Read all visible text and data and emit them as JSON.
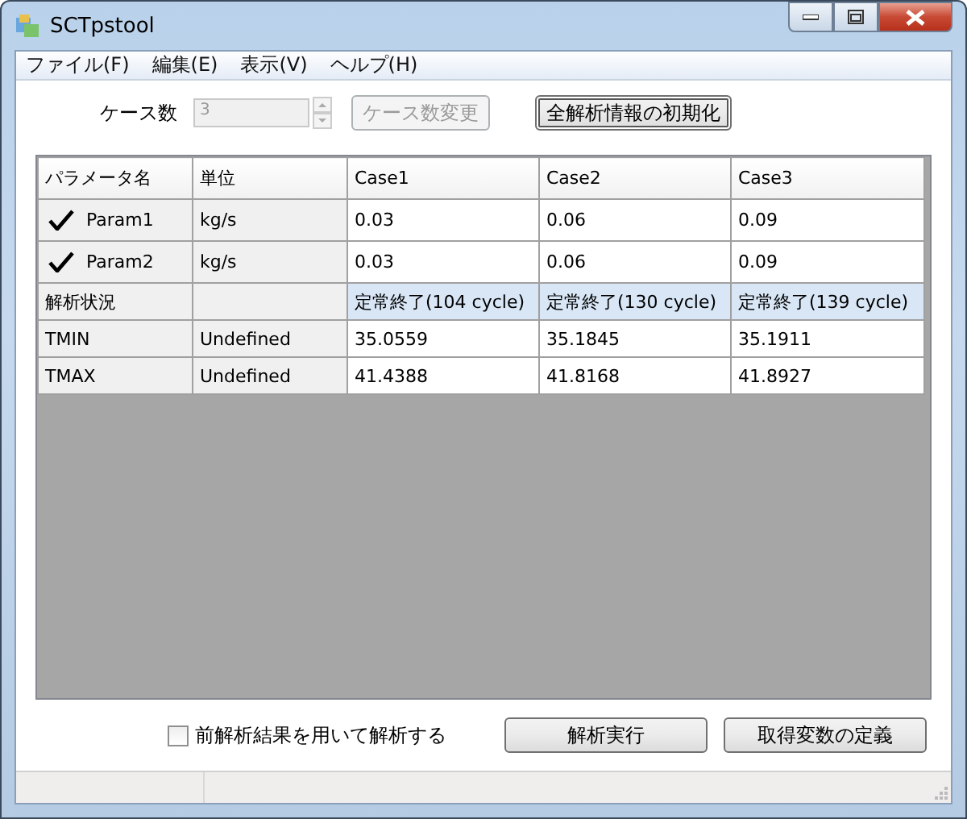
{
  "window": {
    "title": "SCTpstool"
  },
  "menu": [
    "ファイル(F)",
    "編集(E)",
    "表示(V)",
    "ヘルプ(H)"
  ],
  "case_count": {
    "label": "ケース数",
    "value": "3",
    "disabled": true
  },
  "change_button": {
    "label": "ケース数変更",
    "disabled": true
  },
  "reset_button": {
    "label": "全解析情報の初期化",
    "disabled": false
  },
  "table": {
    "columns": [
      "パラメータ名",
      "単位",
      "Case1",
      "Case2",
      "Case3"
    ],
    "rows": [
      {
        "kind": "param",
        "checked": true,
        "cells": [
          "Param1",
          "kg/s",
          "0.03",
          "0.06",
          "0.09"
        ]
      },
      {
        "kind": "param",
        "checked": true,
        "cells": [
          "Param2",
          "kg/s",
          "0.03",
          "0.06",
          "0.09"
        ]
      },
      {
        "kind": "status",
        "cells": [
          "解析状況",
          "",
          "定常終了(104 cycle)",
          "定常終了(130 cycle)",
          "定常終了(139 cycle)"
        ]
      },
      {
        "kind": "plain",
        "cells": [
          "TMIN",
          "Undefined",
          "35.0559",
          "35.1845",
          "35.1911"
        ]
      },
      {
        "kind": "plain",
        "cells": [
          "TMAX",
          "Undefined",
          "41.4388",
          "41.8168",
          "41.8927"
        ]
      }
    ]
  },
  "reuse_checkbox": {
    "label": "前解析結果を用いて解析する",
    "checked": false
  },
  "buttons": [
    "解析実行",
    "取得変数の定義"
  ]
}
